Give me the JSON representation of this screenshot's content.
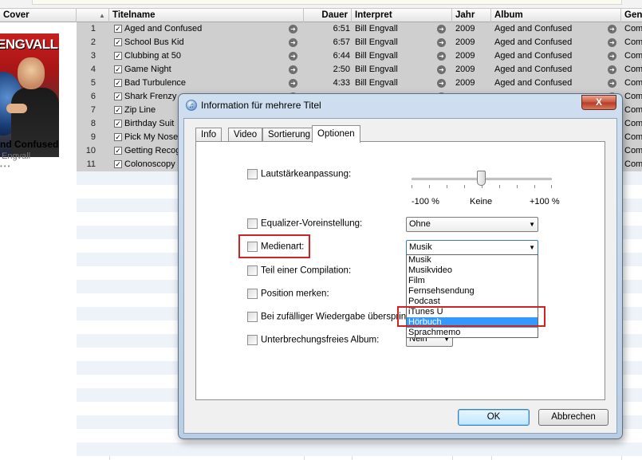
{
  "columns": {
    "cover": "Cover",
    "title": "Titelname",
    "duration": "Dauer",
    "artist": "Interpret",
    "year": "Jahr",
    "album": "Album",
    "genre": "Gen"
  },
  "sort_indicator": "▲",
  "album_panel": {
    "art_text": "ENGVALL",
    "album": "nd Confused",
    "artist": "Engvall",
    "dots": "•••"
  },
  "tracks": [
    {
      "num": "1",
      "title": "Aged and Confused",
      "duration": "6:51",
      "artist": "Bill Engvall",
      "year": "2009",
      "album": "Aged and Confused",
      "genre": "Com"
    },
    {
      "num": "2",
      "title": "School Bus Kid",
      "duration": "6:57",
      "artist": "Bill Engvall",
      "year": "2009",
      "album": "Aged and Confused",
      "genre": "Com"
    },
    {
      "num": "3",
      "title": "Clubbing at 50",
      "duration": "6:44",
      "artist": "Bill Engvall",
      "year": "2009",
      "album": "Aged and Confused",
      "genre": "Com"
    },
    {
      "num": "4",
      "title": "Game Night",
      "duration": "2:50",
      "artist": "Bill Engvall",
      "year": "2009",
      "album": "Aged and Confused",
      "genre": "Com"
    },
    {
      "num": "5",
      "title": "Bad Turbulence",
      "duration": "4:33",
      "artist": "Bill Engvall",
      "year": "2009",
      "album": "Aged and Confused",
      "genre": "Com"
    },
    {
      "num": "6",
      "title": "Shark Frenzy",
      "duration": "",
      "artist": "",
      "year": "",
      "album": "",
      "genre": "Com"
    },
    {
      "num": "7",
      "title": "Zip Line",
      "duration": "",
      "artist": "",
      "year": "",
      "album": "",
      "genre": "Com"
    },
    {
      "num": "8",
      "title": "Birthday Suit",
      "duration": "",
      "artist": "",
      "year": "",
      "album": "",
      "genre": "Com"
    },
    {
      "num": "9",
      "title": "Pick My Nose",
      "duration": "",
      "artist": "",
      "year": "",
      "album": "",
      "genre": "Com"
    },
    {
      "num": "10",
      "title": "Getting Recog",
      "duration": "",
      "artist": "",
      "year": "",
      "album": "",
      "genre": "Com"
    },
    {
      "num": "11",
      "title": "Colonoscopy",
      "duration": "",
      "artist": "",
      "year": "",
      "album": "",
      "genre": "Com"
    }
  ],
  "dialog": {
    "title": "Information für mehrere Titel",
    "close_label": "X",
    "tabs": [
      "Info",
      "Video",
      "Sortierung",
      "Optionen"
    ],
    "active_tab": "Optionen",
    "volume_label": "Lautstärkeanpassung:",
    "volume_min": "-100 %",
    "volume_mid": "Keine",
    "volume_max": "+100 %",
    "volume_value_percent": 0,
    "equalizer_label": "Equalizer-Voreinstellung:",
    "equalizer_value": "Ohne",
    "media_type_label": "Medienart:",
    "media_type_value": "Musik",
    "media_type_options": [
      "Musik",
      "Musikvideo",
      "Film",
      "Fernsehsendung",
      "Podcast",
      "iTunes U",
      "Hörbuch",
      "Sprachmemo"
    ],
    "media_type_highlighted": "Hörbuch",
    "compilation_label": "Teil einer Compilation:",
    "remember_label": "Position merken:",
    "shuffle_label": "Bei zufälliger Wiedergabe überspringen:",
    "gapless_label": "Unterbrechungsfreies Album:",
    "gapless_value": "Nein",
    "ok_label": "OK",
    "cancel_label": "Abbrechen"
  },
  "colors": {
    "selection_row": "#cfcfcf",
    "highlight": "#3399ff",
    "annotation_red": "#d32222"
  }
}
